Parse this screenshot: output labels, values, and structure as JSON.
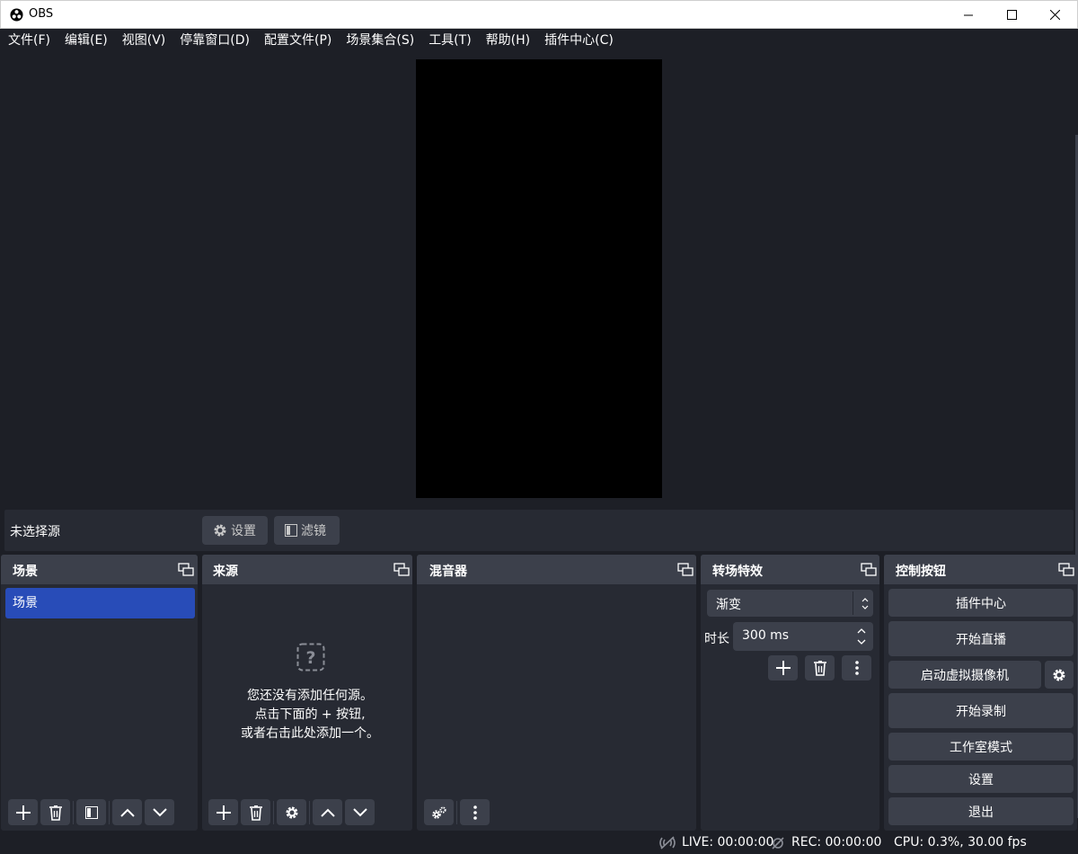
{
  "window": {
    "title": "OBS"
  },
  "menu": [
    "文件(F)",
    "编辑(E)",
    "视图(V)",
    "停靠窗口(D)",
    "配置文件(P)",
    "场景集合(S)",
    "工具(T)",
    "帮助(H)",
    "插件中心(C)"
  ],
  "source_bar": {
    "no_source": "未选择源",
    "settings": "设置",
    "filters": "滤镜"
  },
  "docks": {
    "scenes": {
      "title": "场景",
      "items": [
        "场景"
      ]
    },
    "sources": {
      "title": "来源",
      "empty_line1": "您还没有添加任何源。",
      "empty_line2": "点击下面的 + 按钮,",
      "empty_line3": "或者右击此处添加一个。"
    },
    "mixer": {
      "title": "混音器"
    },
    "transitions": {
      "title": "转场特效",
      "selected": "渐变",
      "duration_label": "时长",
      "duration_value": "300 ms"
    },
    "controls": {
      "title": "控制按钮",
      "plugin_center": "插件中心",
      "start_stream": "开始直播",
      "virtual_cam": "启动虚拟摄像机",
      "start_record": "开始录制",
      "studio_mode": "工作室模式",
      "settings": "设置",
      "exit": "退出"
    }
  },
  "status": {
    "live": "LIVE: 00:00:00",
    "rec": "REC: 00:00:00",
    "cpu": "CPU: 0.3%, 30.00 fps"
  },
  "colors": {
    "bg": "#1d1f26",
    "panel": "#272a33",
    "button": "#3c404b",
    "accent": "#284cb8"
  }
}
